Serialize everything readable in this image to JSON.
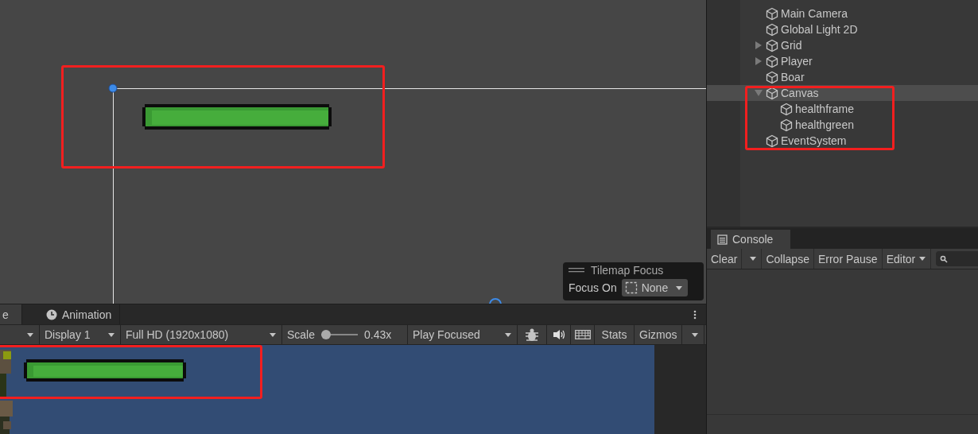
{
  "scene_view": {
    "tilemap_focus": {
      "title": "Tilemap Focus",
      "label": "Focus On",
      "value": "None"
    }
  },
  "hierarchy": {
    "items": [
      {
        "label": "Main Camera",
        "selected": false
      },
      {
        "label": "Global Light 2D",
        "selected": false
      },
      {
        "label": "Grid",
        "selected": false,
        "expanded": false
      },
      {
        "label": "Player",
        "selected": false,
        "expanded": false
      },
      {
        "label": "Boar",
        "selected": false
      },
      {
        "label": "Canvas",
        "selected": true,
        "expanded": true,
        "children": [
          {
            "label": "healthframe",
            "selected": false
          },
          {
            "label": "healthgreen",
            "selected": false
          }
        ]
      },
      {
        "label": "EventSystem",
        "selected": false
      }
    ]
  },
  "console": {
    "tab": "Console",
    "toolbar": {
      "clear": "Clear",
      "collapse": "Collapse",
      "error_pause": "Error Pause",
      "editor": "Editor"
    }
  },
  "game_panel": {
    "tabs": [
      {
        "label": "e",
        "selected": true
      },
      {
        "label": "Animation",
        "selected": false
      }
    ],
    "toolbar": {
      "display": "Display 1",
      "resolution": "Full HD (1920x1080)",
      "scale_label": "Scale",
      "scale": {
        "level": 0
      },
      "scale_value": "0.43x",
      "play_mode": "Play Focused",
      "stats": "Stats",
      "gizmos": "Gizmos"
    }
  }
}
